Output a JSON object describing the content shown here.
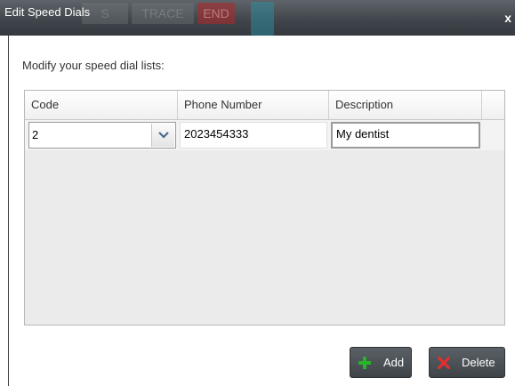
{
  "dialog": {
    "title": "Edit Speed Dials",
    "close_label": "x",
    "background_buttons": [
      "S",
      "TRACE",
      "END"
    ]
  },
  "prompt": "Modify your speed dial lists:",
  "table": {
    "columns": [
      "Code",
      "Phone Number",
      "Description",
      ""
    ],
    "rows": [
      {
        "code": "2",
        "phone": "2023454333",
        "description": "My dentist"
      }
    ]
  },
  "buttons": {
    "add_label": "Add",
    "delete_label": "Delete"
  },
  "colors": {
    "titlebar": "#40464b",
    "add_icon": "#27b32a",
    "delete_icon": "#e03030"
  }
}
